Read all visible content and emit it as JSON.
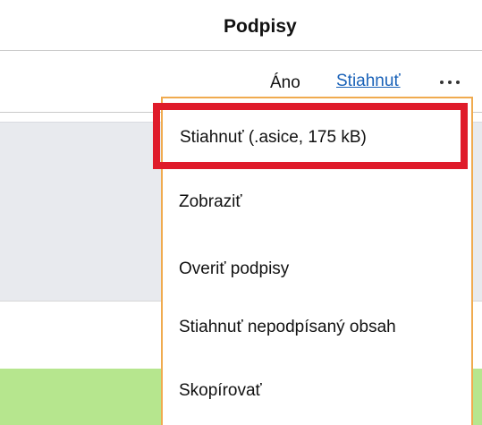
{
  "header": {
    "title": "Podpisy"
  },
  "row": {
    "value": "Áno",
    "download_link": "Stiahnuť",
    "more_icon": "more-icon"
  },
  "menu": {
    "items": [
      {
        "label": "Stiahnuť (.asice, 175 kB)"
      },
      {
        "label": "Zobraziť"
      },
      {
        "label": "Overiť podpisy"
      },
      {
        "label": "Stiahnuť nepodpísaný obsah"
      },
      {
        "label": "Skopírovať"
      }
    ]
  },
  "colors": {
    "link": "#1a62b8",
    "menu_border": "#f0ab4f",
    "highlight": "#df1b2a",
    "grey_band": "#e8eaee",
    "green_band": "#b6e68e"
  }
}
